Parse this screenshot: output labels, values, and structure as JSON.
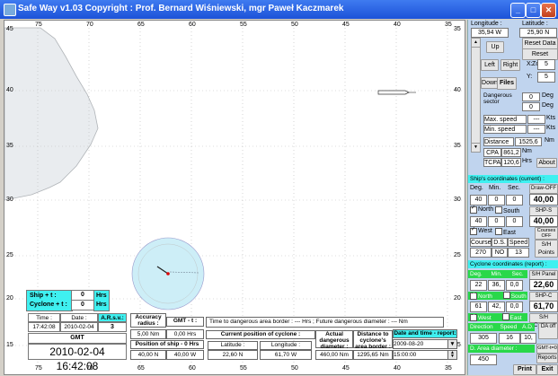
{
  "window": {
    "title": "Safe Way v1.03   Copyright : Prof. Bernard Wiśniewski, mgr Paweł Kaczmarek"
  },
  "map": {
    "top_ticks": [
      "75",
      "70",
      "65",
      "60",
      "55",
      "50",
      "45",
      "40",
      "35"
    ],
    "bottom_ticks": [
      "75",
      "70",
      "65",
      "60",
      "55",
      "50",
      "45",
      "40",
      "35"
    ],
    "left_ticks": [
      "45",
      "40",
      "35",
      "30",
      "25",
      "20",
      "15"
    ],
    "right_ticks": [
      "35",
      "40",
      "35",
      "30",
      "25",
      "20",
      "15"
    ],
    "right_top_tick": "35"
  },
  "panel": {
    "longitude_label": "Longitude :",
    "latitude_label": "Latitude :",
    "longitude_value": "35,94 W",
    "latitude_value": "25,90 N",
    "up": "Up",
    "left": "Left",
    "right": "Right",
    "down": "Down",
    "files": "Files",
    "reset_data": "Reset Data",
    "reset_zoom": "Reset Zoom",
    "x_label": "X:",
    "x_value": "5",
    "y_label": "Y:",
    "y_value": "5",
    "dangerous_sector": "Dangerous sector",
    "deg1": "0",
    "deg_label": "Deg",
    "deg2": "0",
    "deg_label2": "Deg",
    "max_speed": "Max. speed",
    "max_speed_value": "---",
    "kts1": "Kts",
    "min_speed": "Min. speed",
    "min_speed_value": "---",
    "kts2": "Kts",
    "distance": "Distance",
    "distance_value": "1525,6",
    "nm": "Nm",
    "cpa": "CPA",
    "cpa_value": "861,2",
    "cpa_unit": "Nm",
    "tcpa": "TCPA",
    "tcpa_value": "120,6",
    "tcpa_unit": "Hrs",
    "about": "About",
    "ship_coords": "Ship's coordinates (current) :",
    "deg": "Deg.",
    "min": "Min.",
    "sec": "Sec.",
    "draw_off": "Draw-OFF",
    "lat_deg": "40",
    "lat_min": "0",
    "lat_sec": "0",
    "lat_total": "40,00",
    "north": "North",
    "south": "South",
    "shp_s_off": "SHP-S OFF",
    "lon_deg": "40",
    "lon_min": "0",
    "lon_sec": "0",
    "lon_total": "40,00",
    "west": "West",
    "east": "East",
    "course": "Course",
    "ds": "D.S.",
    "speed": "Speed",
    "courses_off": "Courses OFF",
    "course_value": "270",
    "ds_value": "NO",
    "speed_value": "13",
    "sh_points": "S/H Points",
    "cyclone_coords": "Cyclone coordinates (report) :",
    "c_deg": "Deg.",
    "c_min": "Min.",
    "c_sec": "Sec.",
    "sh_panel": "S/H Panel",
    "c_lat_deg": "22",
    "c_lat_min": "36,",
    "c_lat_sec": "0,0",
    "c_lat_total": "22,60",
    "c_north": "North",
    "c_south": "South",
    "shp_c_off": "SHP-C OFF",
    "c_lon_deg": "61",
    "c_lon_min": "42,",
    "c_lon_sec": "0,0",
    "c_lon_total": "61,70",
    "c_west": "West",
    "c_east": "East",
    "sh_cyclone": "S/H Cyclone",
    "direction": "Direction",
    "c_speed": "Speed",
    "ad": "A.D.",
    "da_off": "DA off",
    "direction_value": "305",
    "c_speed_value": "16",
    "ad_value": "10,",
    "d_area": "D. Area diameter :",
    "gmt_on": "GMT-t=0 ON",
    "d_area_value": "450",
    "reports": "Reports",
    "print": "Print",
    "exit": "Exit"
  },
  "bottom": {
    "ship_t": "Ship + t :",
    "ship_t_value": "0",
    "ship_t_unit": "Hrs",
    "cyclone_t": "Cyclone + t :",
    "cyclone_t_value": "0",
    "cyclone_t_unit": "Hrs",
    "time_label": "Time :",
    "date_label": "Date :",
    "asv_label": "A.R.s.v.:",
    "time_value": "17:42:08",
    "date_value": "2010-02-04",
    "asv_value": "3",
    "gmt_label": "GMT",
    "datetime_big": "2010-02-04 16:42:08",
    "accuracy_label": "Accuracy radius :",
    "accuracy_value": "5,00 Nm",
    "gmt_t_label": "GMT - t :",
    "gmt_t_value": "0,00 Hrs",
    "info_text": "Time to dangerous area border : --- Hrs ;  Future dangerous diameter : --- Nm",
    "pos_ship_label": "Position of ship - 0 Hrs",
    "ship_lat": "40,00 N",
    "ship_lon": "40,00 W",
    "curr_pos_label": "Current position of cyclone :",
    "lat_label": "Latitude :",
    "lon_label": "Longitude :",
    "cyc_lat": "22,60 N",
    "cyc_lon": "61,70 W",
    "actual_diam_label": "Actual dangerous diameter :",
    "actual_diam_value": "460,00 Nm",
    "dist_border_label": "Distance to cyclone's area border :",
    "dist_border_value": "1295,65 Nm",
    "dt_report_label": "Date and time - report:",
    "dt_report_date": "2009-08-20",
    "dt_report_time": "15:00:00"
  }
}
